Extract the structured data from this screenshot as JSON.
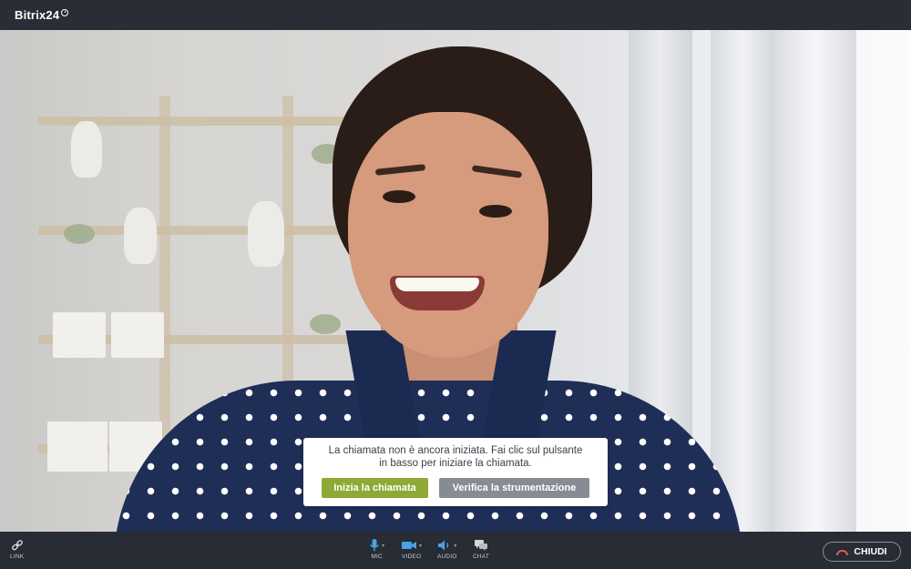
{
  "app": {
    "logo_text": "Bitrix24",
    "logo_icon": "clock-icon"
  },
  "dialog": {
    "message": "La chiamata non è ancora iniziata. Fai clic sul pulsante in basso per iniziare la chiamata.",
    "start_button": "Inizia la chiamata",
    "check_button": "Verifica la strumentazione",
    "start_color": "#8eaa35",
    "check_color": "#878c94"
  },
  "controls": {
    "link": {
      "label": "LINK",
      "icon": "link-icon"
    },
    "mic": {
      "label": "MIC",
      "icon": "microphone-icon"
    },
    "video": {
      "label": "VIDEO",
      "icon": "camera-icon"
    },
    "audio": {
      "label": "AUDIO",
      "icon": "speaker-icon"
    },
    "chat": {
      "label": "CHAT",
      "icon": "chat-icon"
    },
    "hangup": {
      "label": "CHIUDI",
      "icon": "hangup-icon",
      "color": "#e9584a"
    }
  },
  "colors": {
    "bar_background": "#272c35",
    "accent_blue": "#4aa2e6"
  }
}
